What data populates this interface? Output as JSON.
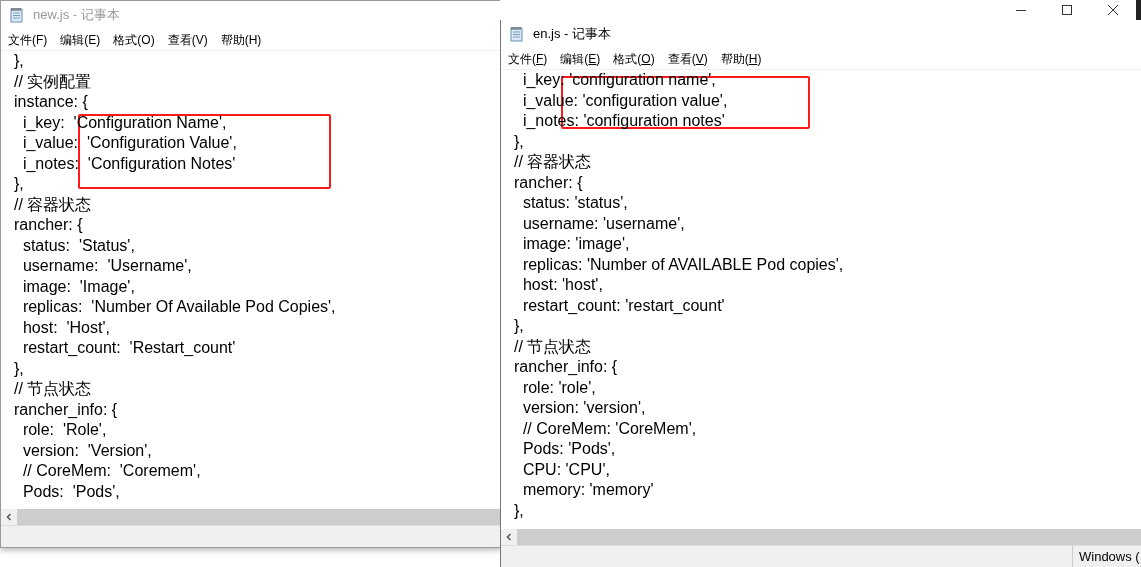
{
  "windows": [
    {
      "title": "new.js - 记事本",
      "active": false,
      "menu_underlined": false,
      "highlight_box": true,
      "menu": [
        "文件(F)",
        "编辑(E)",
        "格式(O)",
        "查看(V)",
        "帮助(H)"
      ],
      "lines": [
        "},",
        "// 实例配置",
        "instance: {",
        "  i_key:  'Configuration Name',",
        "  i_value:  'Configuration Value',",
        "  i_notes:  'Configuration Notes'",
        "},",
        "// 容器状态",
        "rancher: {",
        "  status:  'Status',",
        "  username:  'Username',",
        "  image:  'Image',",
        "  replicas:  'Number Of Available Pod Copies',",
        "  host:  'Host',",
        "  restart_count:  'Restart_count'",
        "},",
        "// 节点状态",
        "rancher_info: {",
        "  role:  'Role',",
        "  version:  'Version',",
        "  // CoreMem:  'Coremem',",
        "  Pods:  'Pods',"
      ]
    },
    {
      "title": "en.js - 记事本",
      "active": true,
      "menu_underlined": true,
      "highlight_box": true,
      "menu": [
        "文件(F)",
        "编辑(E)",
        "格式(O)",
        "查看(V)",
        "帮助(H)"
      ],
      "lines": [
        "  i_key: 'configuration name',",
        "  i_value: 'configuration value',",
        "  i_notes: 'configuration notes'",
        "},",
        "// 容器状态",
        "rancher: {",
        "  status: 'status',",
        "  username: 'username',",
        "  image: 'image',",
        "  replicas: 'Number of AVAILABLE Pod copies',",
        "  host: 'host',",
        "  restart_count: 'restart_count'",
        "},",
        "// 节点状态",
        "rancher_info: {",
        "  role: 'role',",
        "  version: 'version',",
        "  // CoreMem: 'CoreMem',",
        "  Pods: 'Pods',",
        "  CPU: 'CPU',",
        "  memory: 'memory'",
        "},"
      ],
      "status_text": "Windows ("
    }
  ]
}
